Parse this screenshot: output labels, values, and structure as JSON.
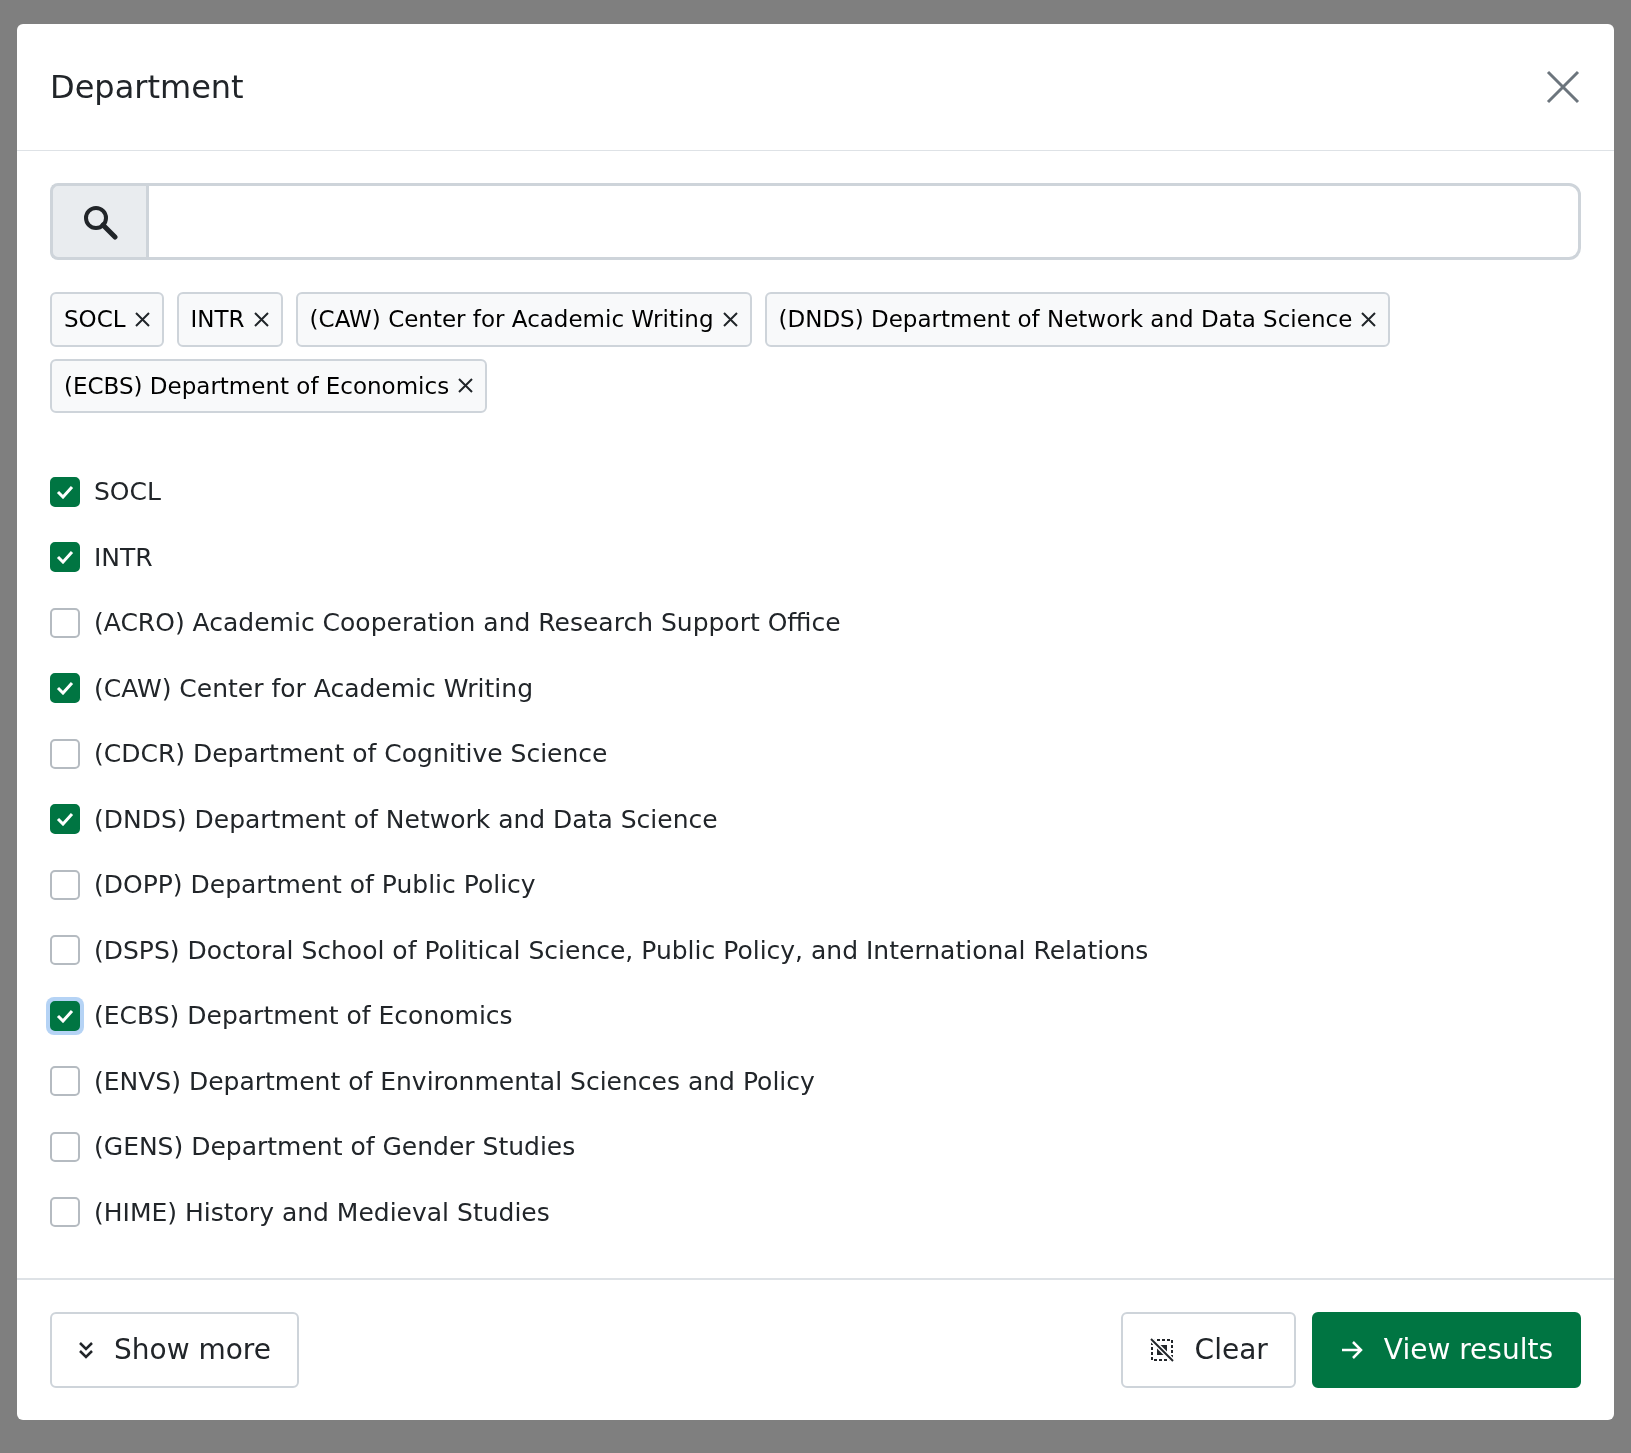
{
  "dialog": {
    "title": "Department",
    "chips": [
      {
        "label": "SOCL"
      },
      {
        "label": "INTR"
      },
      {
        "label": "(CAW) Center for Academic Writing"
      },
      {
        "label": "(DNDS) Department of Network and Data Science"
      },
      {
        "label": "(ECBS) Department of Economics"
      }
    ],
    "options": [
      {
        "label": "SOCL",
        "checked": true,
        "focused": false
      },
      {
        "label": "INTR",
        "checked": true,
        "focused": false
      },
      {
        "label": "(ACRO) Academic Cooperation and Research Support Office",
        "checked": false,
        "focused": false
      },
      {
        "label": "(CAW) Center for Academic Writing",
        "checked": true,
        "focused": false
      },
      {
        "label": "(CDCR) Department of Cognitive Science",
        "checked": false,
        "focused": false
      },
      {
        "label": "(DNDS) Department of Network and Data Science",
        "checked": true,
        "focused": false
      },
      {
        "label": "(DOPP) Department of Public Policy",
        "checked": false,
        "focused": false
      },
      {
        "label": "(DSPS) Doctoral School of Political Science, Public Policy, and International Relations",
        "checked": false,
        "focused": false
      },
      {
        "label": "(ECBS) Department of Economics",
        "checked": true,
        "focused": true
      },
      {
        "label": "(ENVS) Department of Environmental Sciences and Policy",
        "checked": false,
        "focused": false
      },
      {
        "label": "(GENS) Department of Gender Studies",
        "checked": false,
        "focused": false
      },
      {
        "label": "(HIME) History and Medieval Studies",
        "checked": false,
        "focused": false
      }
    ],
    "buttons": {
      "show_more": "Show more",
      "clear": "Clear",
      "view_results": "View results"
    }
  }
}
